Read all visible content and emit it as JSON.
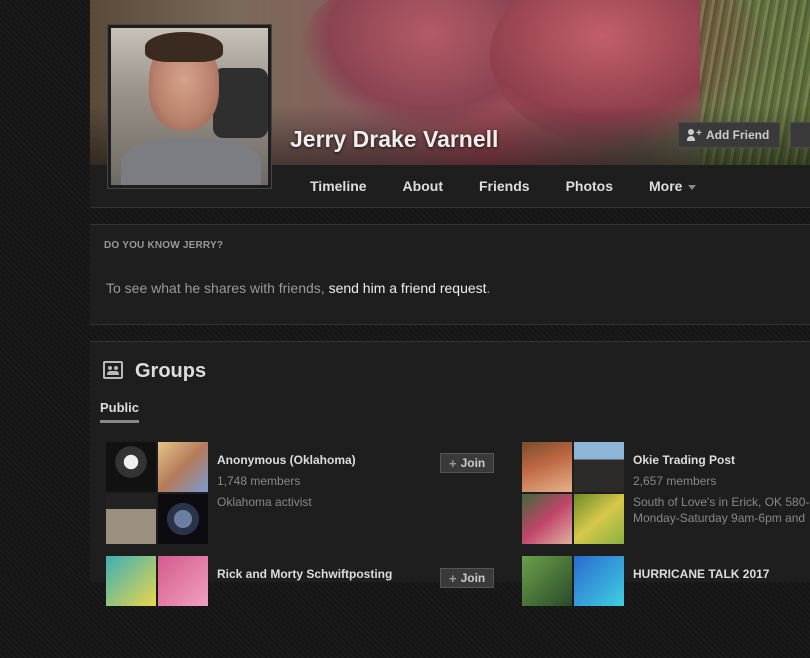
{
  "profile": {
    "name": "Jerry Drake Varnell",
    "add_friend_label": "Add Friend",
    "tabs": [
      {
        "label": "Timeline"
      },
      {
        "label": "About"
      },
      {
        "label": "Friends"
      },
      {
        "label": "Photos"
      },
      {
        "label": "More"
      }
    ]
  },
  "know_box": {
    "heading": "DO YOU KNOW JERRY?",
    "text_before": "To see what he shares with friends, ",
    "link_text": "send him a friend request",
    "text_after": "."
  },
  "groups": {
    "title": "Groups",
    "subtab": "Public",
    "join_label": "Join",
    "items": [
      {
        "name": "Anonymous (Oklahoma)",
        "members": "1,748 members",
        "description": "Oklahoma activist",
        "description2": ""
      },
      {
        "name": "Okie Trading Post",
        "members": "2,657 members",
        "description": "South of Love's in Erick, OK 580-",
        "description2": "Monday-Saturday 9am-6pm and"
      },
      {
        "name": "Rick and Morty Schwiftposting",
        "members": "",
        "description": "",
        "description2": ""
      },
      {
        "name": "HURRICANE TALK 2017",
        "members": "",
        "description": "",
        "description2": ""
      }
    ]
  },
  "colors": {
    "background": "#161616",
    "panel": "#1e1e1e",
    "text": "#dddddd",
    "muted": "#888888"
  }
}
